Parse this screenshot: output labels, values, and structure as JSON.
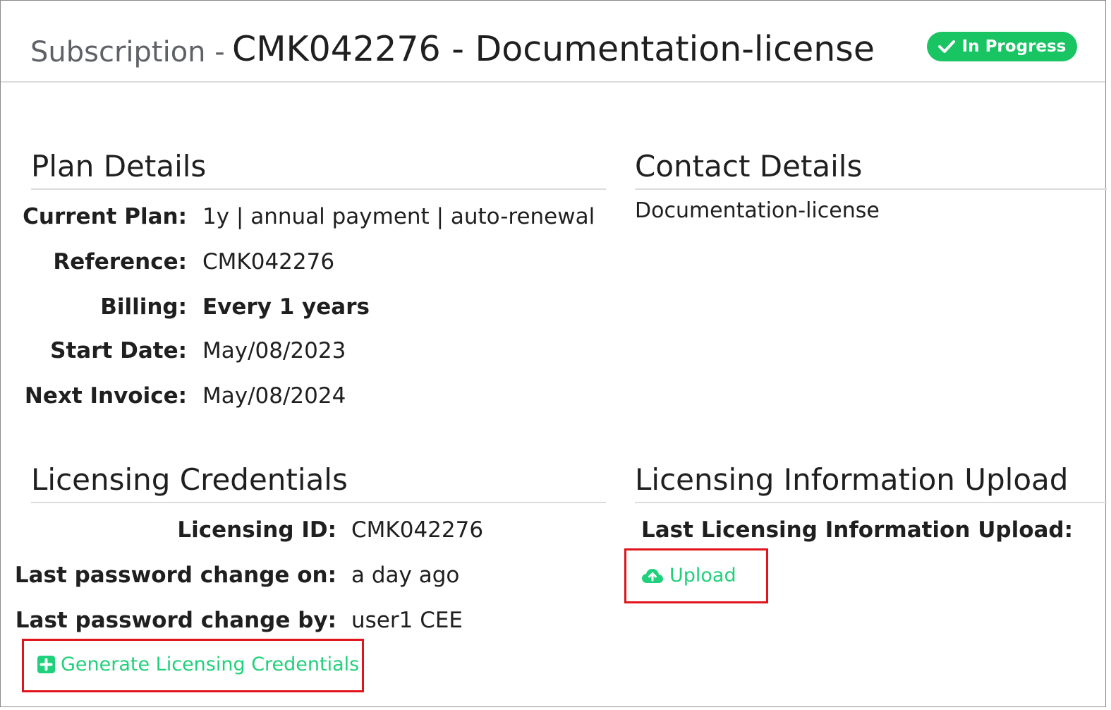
{
  "header": {
    "title_prefix": "Subscription -",
    "title_main": "CMK042276 - Documentation-license",
    "status": "In Progress",
    "status_color": "#19c463"
  },
  "plan_details": {
    "title": "Plan Details",
    "rows": [
      {
        "label": "Current Plan:",
        "value": "1y | annual payment | auto-renewal"
      },
      {
        "label": "Reference:",
        "value": "CMK042276"
      },
      {
        "label": "Billing:",
        "value": "Every 1 years"
      },
      {
        "label": "Start Date:",
        "value": "May/08/2023"
      },
      {
        "label": "Next Invoice:",
        "value": "May/08/2024"
      }
    ]
  },
  "contact_details": {
    "title": "Contact Details",
    "value": "Documentation-license"
  },
  "licensing_credentials": {
    "title": "Licensing Credentials",
    "rows": [
      {
        "label": "Licensing ID:",
        "value": "CMK042276"
      },
      {
        "label": "Last password change on:",
        "value": "a day ago"
      },
      {
        "label": "Last password change by:",
        "value": "user1 CEE"
      }
    ],
    "generate_label": "Generate Licensing Credentials",
    "generate_icon": "plus-square-icon"
  },
  "licensing_upload": {
    "title": "Licensing Information Upload",
    "last_upload_label": "Last Licensing Information Upload:",
    "upload_label": "Upload",
    "upload_icon": "cloud-upload-icon"
  },
  "colors": {
    "accent_green": "#1fd17a",
    "highlight_red": "#e0141b"
  }
}
